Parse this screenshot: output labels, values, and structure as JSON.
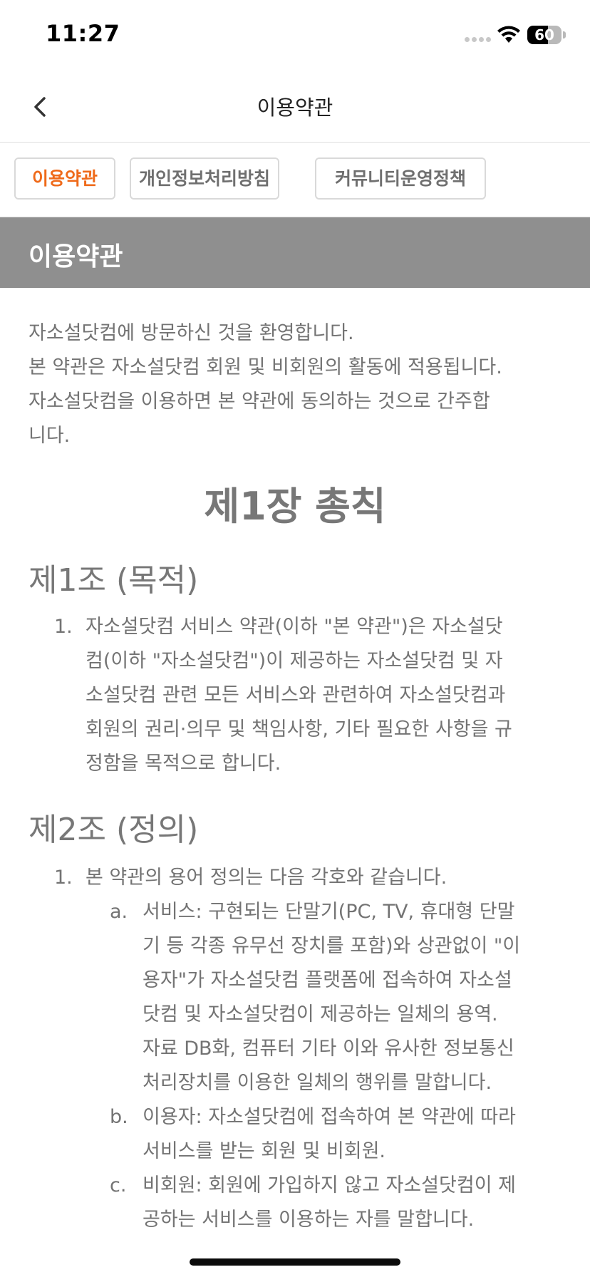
{
  "status_bar": {
    "time": "11:27",
    "battery_level": "60",
    "battery_percent": 0.6
  },
  "header": {
    "title": "이용약관"
  },
  "tabs": [
    {
      "label": "이용약관",
      "active": true
    },
    {
      "label": "개인정보처리방침",
      "active": false
    },
    {
      "label": "커뮤니티운영정책",
      "active": false
    }
  ],
  "section": {
    "title": "이용약관"
  },
  "intro": {
    "lines": [
      "자소설닷컴에 방문하신 것을 환영합니다.",
      "본 약관은 자소설닷컴 회원 및 비회원의 활동에 적용됩니다.",
      "자소설닷컴을 이용하면 본 약관에 동의하는 것으로 간주합",
      "니다."
    ]
  },
  "chapter": {
    "title": "제1장 총칙"
  },
  "article1": {
    "title": "제1조 (목적)",
    "items": [
      {
        "marker": "1.",
        "lines": [
          "자소설닷컴 서비스 약관(이하 \"본 약관\")은 자소설닷",
          "컴(이하 \"자소설닷컴\")이 제공하는 자소설닷컴 및 자",
          "소설닷컴 관련 모든 서비스와 관련하여 자소설닷컴과",
          "회원의 권리·의무 및 책임사항, 기타 필요한 사항을 규",
          "정함을 목적으로 합니다."
        ]
      }
    ]
  },
  "article2": {
    "title": "제2조 (정의)",
    "items": [
      {
        "marker": "1.",
        "lines": [
          "본 약관의 용어 정의는 다음 각호와 같습니다."
        ],
        "subitems": [
          {
            "marker": "a.",
            "lines": [
              "서비스: 구현되는 단말기(PC, TV, 휴대형 단말",
              "기 등 각종 유무선 장치를 포함)와 상관없이 \"이",
              "용자\"가 자소설닷컴 플랫폼에 접속하여 자소설",
              "닷컴 및 자소설닷컴이 제공하는 일체의 용역.",
              "자료 DB화, 컴퓨터 기타 이와 유사한 정보통신",
              "처리장치를 이용한 일체의 행위를 말합니다."
            ]
          },
          {
            "marker": "b.",
            "lines": [
              "이용자: 자소설닷컴에 접속하여 본 약관에 따라",
              "서비스를 받는 회원 및 비회원."
            ]
          },
          {
            "marker": "c.",
            "lines": [
              "비회원: 회원에 가입하지 않고 자소설닷컴이 제",
              "공하는 서비스를 이용하는 자를 말합니다."
            ]
          }
        ]
      }
    ]
  },
  "colors": {
    "accent": "#ef6a1a",
    "banner": "#8f8f8f",
    "text": "#737373",
    "border": "#d9d9d9"
  },
  "icons": {
    "back": "chevron-left-icon",
    "wifi": "wifi-icon",
    "signal": "cellular-signal-icon",
    "battery": "battery-icon"
  }
}
